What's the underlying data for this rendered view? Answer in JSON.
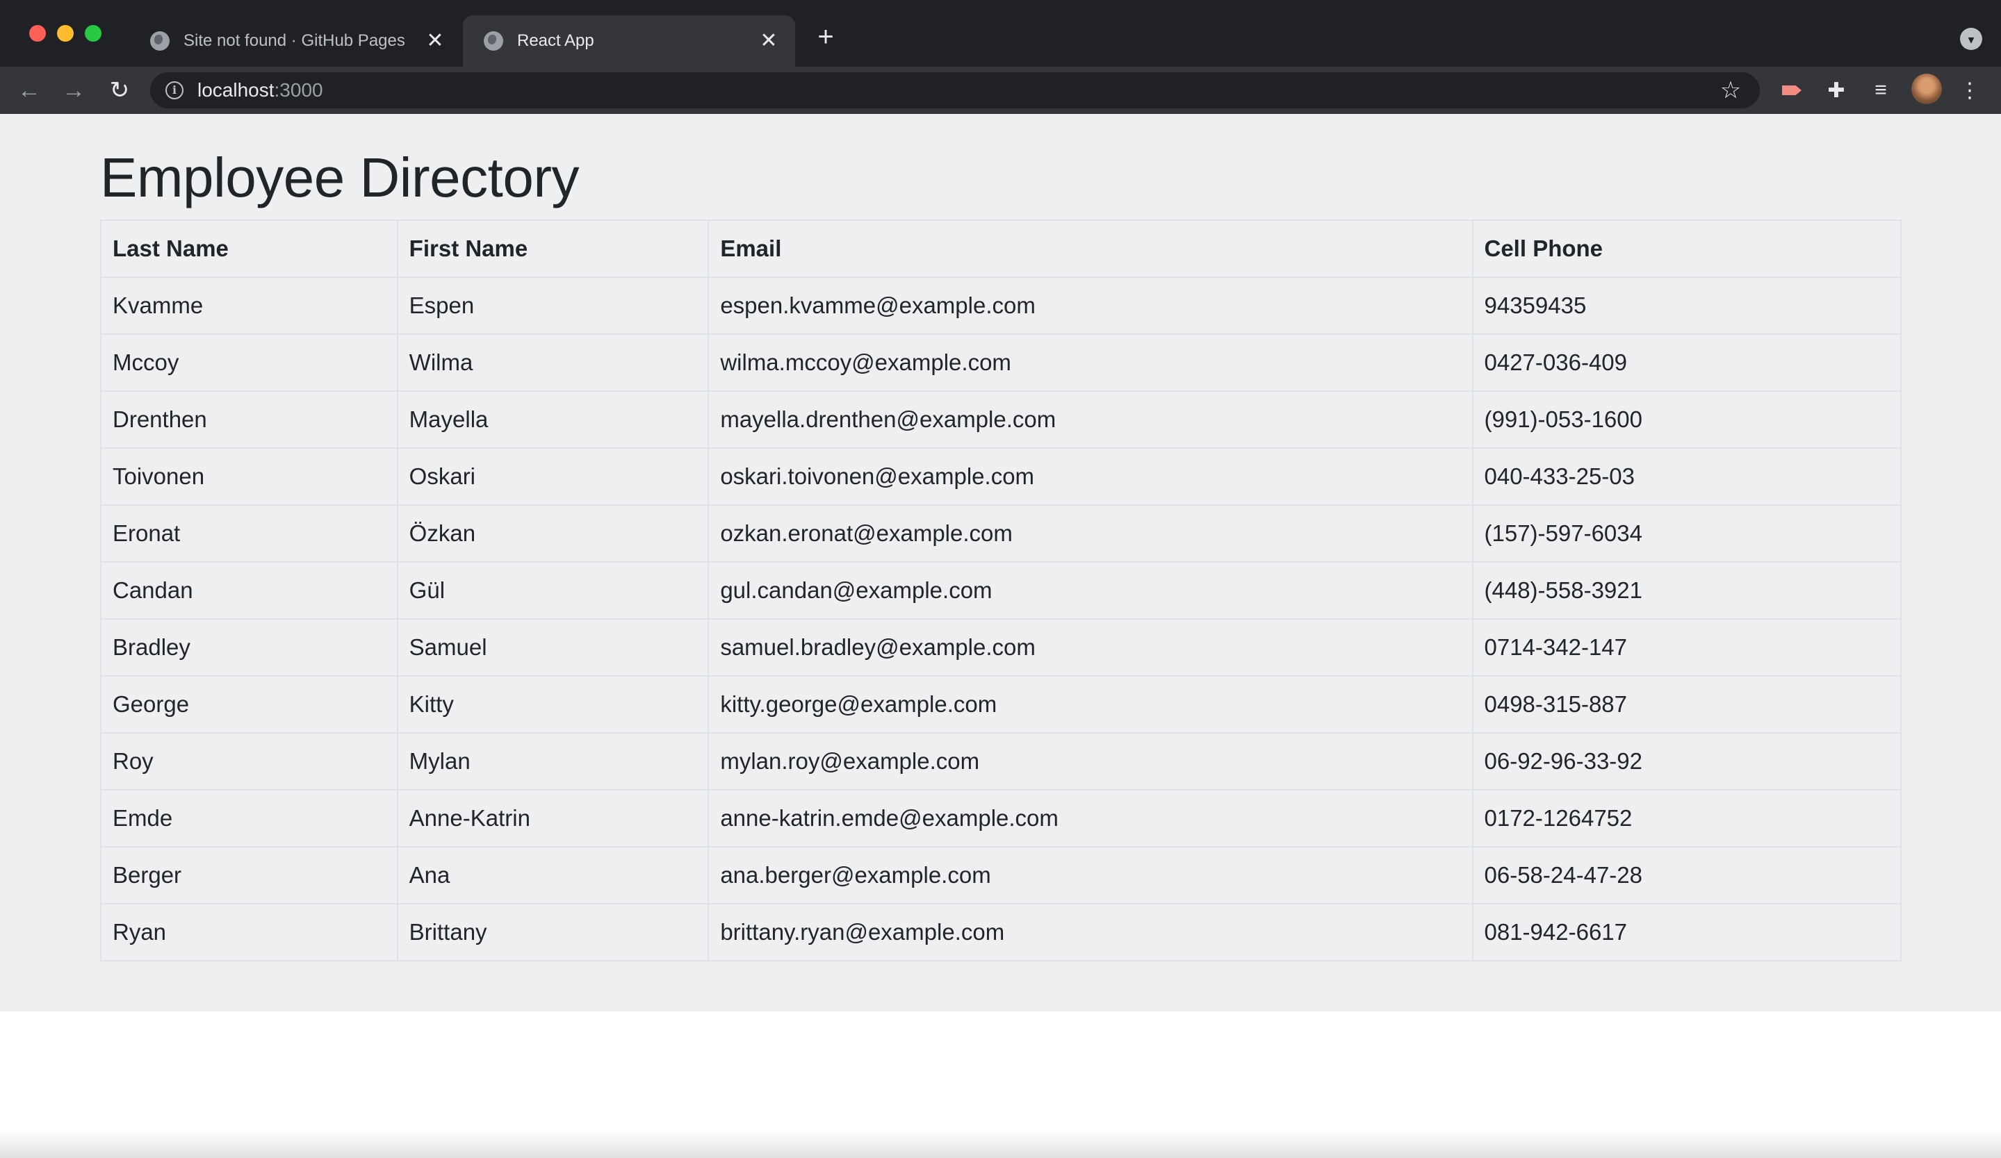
{
  "browser": {
    "tabs": [
      {
        "title": "Site not found · GitHub Pages",
        "active": false,
        "close": "✕"
      },
      {
        "title": "React App",
        "active": true,
        "close": "✕"
      }
    ],
    "new_tab_glyph": "+",
    "tab_search_glyph": "▾",
    "nav": {
      "back_glyph": "←",
      "forward_glyph": "→",
      "reload_glyph": "↻"
    },
    "url": {
      "host": "localhost",
      "port": ":3000"
    },
    "info_glyph": "i",
    "star_glyph": "☆",
    "extensions": [
      {
        "name": "red-extension-icon"
      },
      {
        "name": "puzzle-icon",
        "glyph": "✚"
      },
      {
        "name": "media-queue-icon",
        "glyph": "≡"
      },
      {
        "name": "avatar"
      },
      {
        "name": "menu-icon",
        "glyph": "⋮"
      }
    ],
    "colors": {
      "frame": "#202124",
      "toolbar": "#35363a",
      "text": "#e8eaed"
    }
  },
  "page": {
    "title": "Employee Directory",
    "background": "#eeeff1",
    "table": {
      "headers": [
        "Last Name",
        "First Name",
        "Email",
        "Cell Phone"
      ],
      "rows": [
        [
          "Kvamme",
          "Espen",
          "espen.kvamme@example.com",
          "94359435"
        ],
        [
          "Mccoy",
          "Wilma",
          "wilma.mccoy@example.com",
          "0427-036-409"
        ],
        [
          "Drenthen",
          "Mayella",
          "mayella.drenthen@example.com",
          "(991)-053-1600"
        ],
        [
          "Toivonen",
          "Oskari",
          "oskari.toivonen@example.com",
          "040-433-25-03"
        ],
        [
          "Eronat",
          "Özkan",
          "ozkan.eronat@example.com",
          "(157)-597-6034"
        ],
        [
          "Candan",
          "Gül",
          "gul.candan@example.com",
          "(448)-558-3921"
        ],
        [
          "Bradley",
          "Samuel",
          "samuel.bradley@example.com",
          "0714-342-147"
        ],
        [
          "George",
          "Kitty",
          "kitty.george@example.com",
          "0498-315-887"
        ],
        [
          "Roy",
          "Mylan",
          "mylan.roy@example.com",
          "06-92-96-33-92"
        ],
        [
          "Emde",
          "Anne-Katrin",
          "anne-katrin.emde@example.com",
          "0172-1264752"
        ],
        [
          "Berger",
          "Ana",
          "ana.berger@example.com",
          "06-58-24-47-28"
        ],
        [
          "Ryan",
          "Brittany",
          "brittany.ryan@example.com",
          "081-942-6617"
        ]
      ]
    }
  }
}
